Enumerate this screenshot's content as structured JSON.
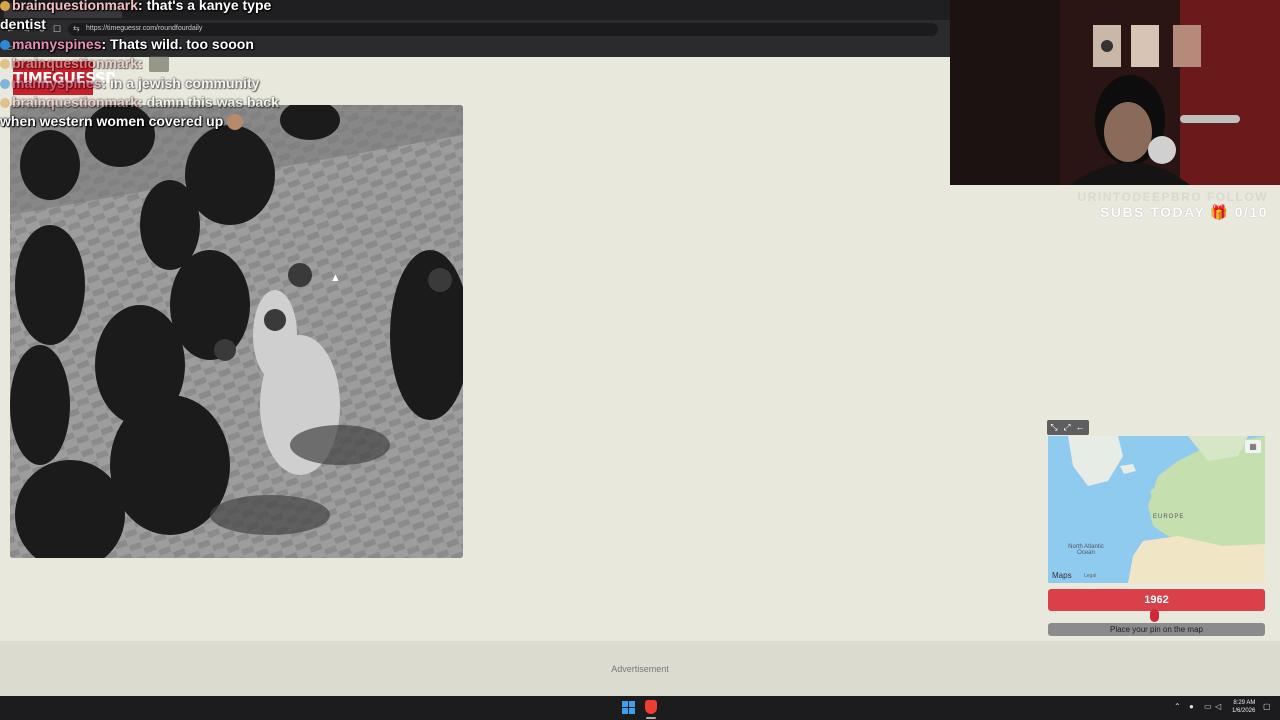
{
  "browser": {
    "tab_title": "",
    "url": "https://timeguessr.com/roundfourdaily"
  },
  "site": {
    "logo_text": "TIMEGUESSR"
  },
  "chat": {
    "messages": [
      {
        "user": "brainquestionmark",
        "text": ": that's a kanye type"
      },
      {
        "user": "",
        "text": "dentist"
      },
      {
        "user": "mannyspines",
        "text": ": Thats wild. too sooon"
      },
      {
        "user": "brainquestionmark",
        "text": ":"
      },
      {
        "user": "mannyspines",
        "text": ": in a jewish community"
      },
      {
        "user": "brainquestionmark",
        "text": ": damn this was back"
      },
      {
        "user": "",
        "text": "when western women covered up"
      }
    ]
  },
  "stream_overlay": {
    "follow_text": "URINTODEEPBRO FOLLOW",
    "subs_text": "SUBS TODAY 🎁 0/10"
  },
  "map": {
    "label_europe": "EUROPE",
    "label_ocean": "North Atlantic Ocean",
    "brand": "Maps",
    "legal": "Legal"
  },
  "game": {
    "year": "1962",
    "place_pin_label": "Place your pin on the map",
    "year_fraction": 0.49
  },
  "ad": {
    "label": "Advertisement"
  },
  "taskbar": {
    "time": "8:29 AM",
    "date": "1/6/2026"
  },
  "colors": {
    "background": "#e9e8dc",
    "accent_red": "#d9404a",
    "map_water": "#8fcbef"
  }
}
